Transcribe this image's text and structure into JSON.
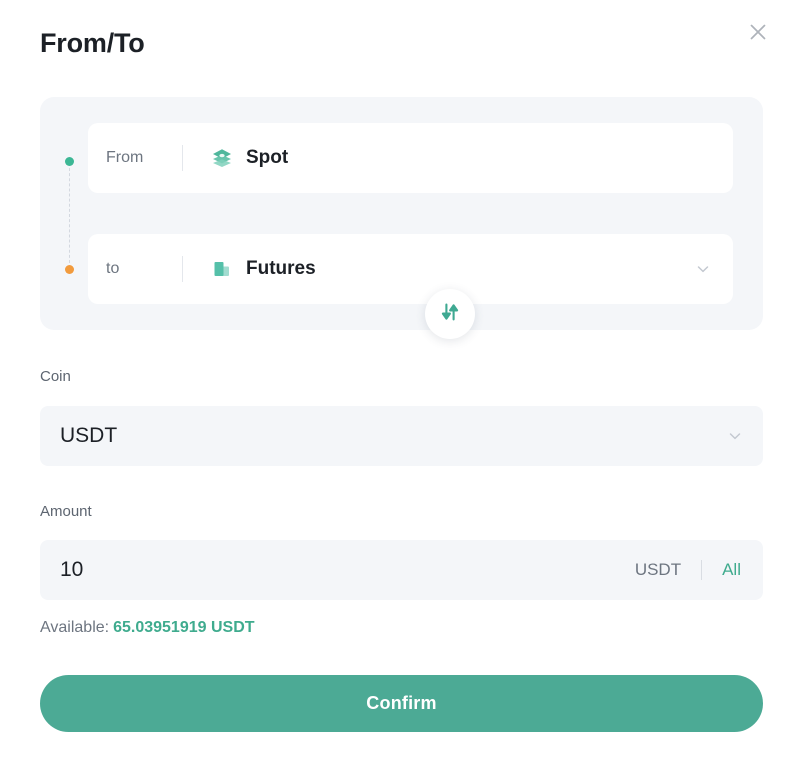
{
  "header": {
    "title": "From/To",
    "close_icon": "close-icon"
  },
  "transfer": {
    "from": {
      "label": "From",
      "value": "Spot",
      "icon": "layers-icon",
      "bullet_color": "#3cb795"
    },
    "to": {
      "label": "to",
      "value": "Futures",
      "icon": "bar-chart-icon",
      "bullet_color": "#f29b3d",
      "chevron_icon": "chevron-down-icon"
    },
    "swap_icon": "swap-vertical-arrows-icon"
  },
  "coin": {
    "label": "Coin",
    "value": "USDT",
    "chevron_icon": "chevron-down-icon"
  },
  "amount": {
    "label": "Amount",
    "value": "10",
    "unit": "USDT",
    "all_label": "All"
  },
  "available": {
    "label": "Available:",
    "value": "65.03951919 USDT"
  },
  "actions": {
    "confirm_label": "Confirm"
  },
  "colors": {
    "accent": "#4caa95",
    "accent_text": "#3fab8e",
    "orange": "#f29b3d",
    "panel_bg": "#f4f6f9"
  }
}
